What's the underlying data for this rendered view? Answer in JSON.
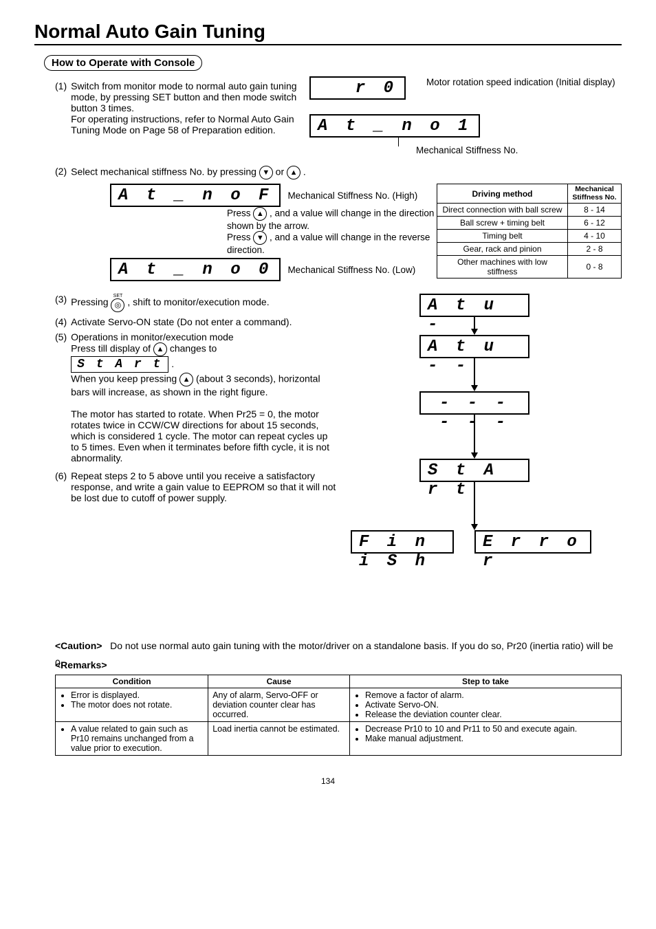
{
  "title": "Normal Auto Gain Tuning",
  "section_title": "How to Operate with Console",
  "steps": {
    "s1_num": "(1)",
    "s1a": "Switch from monitor mode to normal auto gain tuning mode, by pressing SET button and then mode switch button 3 times.",
    "s1b": "For operating instructions, refer to  Normal Auto Gain Tuning Mode  on Page 58 of Preparation edition.",
    "s2_num": "(2)",
    "s2": "Select mechanical stiffness No. by pressing ",
    "s2_after": " or ",
    "s2_end": " .",
    "s3_num": "(3)",
    "s3a": "Pressing ",
    "s3b": ", shift to monitor/execution mode.",
    "s4_num": "(4)",
    "s4": "Activate Servo-ON state (Do not enter a command).",
    "s5_num": "(5)",
    "s5a": "Operations in monitor/execution mode",
    "s5b": "Press till display of ",
    "s5c": " changes to",
    "s5d": ".",
    "s5e": "When you keep pressing ",
    "s5f": " (about 3 seconds), horizontal bars will increase, as shown in the right figure.",
    "s5g": "The motor has started to rotate.    When Pr25 = 0, the motor rotates twice in CCW/CW directions for about 15 seconds, which is considered 1 cycle. The motor can repeat cycles up to 5 times.  Even when it terminates before fifth cycle, it is not abnormality.",
    "s6_num": "(6)",
    "s6": "Repeat steps 2 to 5 above until you receive a satisfactory response, and write a gain value to EEPROM so that it will not be lost due to cutoff of power supply."
  },
  "displays": {
    "motor_speed": "r                0",
    "at_no1": "A t _ n o 1",
    "at_noF": "A t _ n o F",
    "at_no0": "A t _ n o 0",
    "start_small": "S t A r t",
    "atu1": "A t u       -",
    "atu2": "A t u     - -",
    "bars": "- - - - - -",
    "start": "S t A r t",
    "finish": "F i n i S h",
    "error": "E r r o r"
  },
  "labels": {
    "motor_speed_lbl": "Motor rotation speed indication (Initial display)",
    "mech_stiff_no": "Mechanical Stiffness No.",
    "mech_high": "Mechanical Stiffness No. (High)",
    "mech_low": "Mechanical Stiffness No. (Low)",
    "press_up": "Press ",
    "press_up2": ", and a value will change in the direction shown by the arrow.",
    "press_dn": "Press ",
    "press_dn2": ", and a value will change in the reverse direction.",
    "set_btn": "SET"
  },
  "stiffness_table": {
    "h1": "Driving method",
    "h2": "Mechanical Stiffness No.",
    "rows": [
      {
        "m": "Direct connection with ball screw",
        "v": "8 - 14"
      },
      {
        "m": "Ball screw + timing belt",
        "v": "6 - 12"
      },
      {
        "m": "Timing belt",
        "v": "4 - 10"
      },
      {
        "m": "Gear, rack and pinion",
        "v": "2 - 8"
      },
      {
        "m": "Other machines with low stiffness",
        "v": "0 - 8"
      }
    ]
  },
  "caution_label": "<Caution>",
  "caution_text": "Do not use normal auto gain tuning with the motor/driver on a standalone basis.  If you do so, Pr20 (inertia ratio) will be 0.",
  "remarks_label": "<Remarks>",
  "remarks_table": {
    "h1": "Condition",
    "h2": "Cause",
    "h3": "Step to take",
    "rows": [
      {
        "cond": [
          "Error is displayed.",
          "The motor does not rotate."
        ],
        "cause": "Any of alarm, Servo-OFF or deviation counter clear has occurred.",
        "step": [
          "Remove a factor of alarm.",
          "Activate Servo-ON.",
          "Release the deviation counter clear."
        ]
      },
      {
        "cond": [
          "A value related to gain such as Pr10 remains unchanged from a value prior to execution."
        ],
        "cause": "Load inertia cannot be estimated.",
        "step": [
          "Decrease Pr10 to 10 and Pr11 to 50 and execute again.",
          "Make manual adjustment."
        ]
      }
    ]
  },
  "page_no": "134"
}
